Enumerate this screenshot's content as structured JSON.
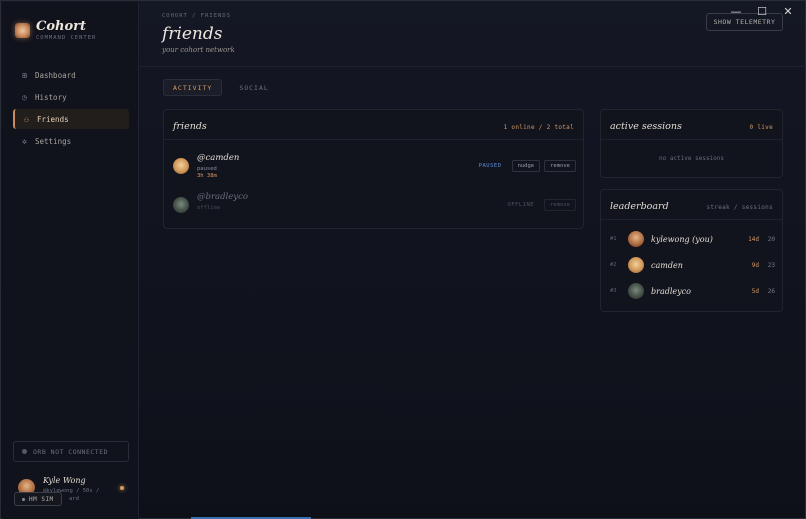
{
  "window": {
    "controls": [
      "—",
      "☐",
      "✕"
    ]
  },
  "brand": {
    "name": "Cohort",
    "subtitle": "COMMAND CENTER"
  },
  "nav": [
    {
      "label": "Dashboard",
      "icon": "grid-icon",
      "glyph": "⊞"
    },
    {
      "label": "History",
      "icon": "clock-icon",
      "glyph": "◷"
    },
    {
      "label": "Friends",
      "icon": "users-icon",
      "glyph": "⚇",
      "active": true
    },
    {
      "label": "Settings",
      "icon": "gear-icon",
      "glyph": "✲"
    }
  ],
  "orb": {
    "label": "ORB NOT CONNECTED"
  },
  "user": {
    "name": "Kyle Wong",
    "meta1": "@kylewong / 50s /",
    "meta2": "ard"
  },
  "hmsim": {
    "label": "HM SIM"
  },
  "header": {
    "breadcrumb": "COHORT / FRIENDS",
    "title": "friends",
    "subtitle": "your cohort network",
    "telemetry_button": "SHOW TELEMETRY"
  },
  "tabs": [
    {
      "label": "ACTIVITY",
      "active": true
    },
    {
      "label": "SOCIAL",
      "active": false
    }
  ],
  "friends_card": {
    "title": "friends",
    "count": "1 online / 2 total",
    "rows": [
      {
        "name": "@camden",
        "status": "paused",
        "time": "3h 38m",
        "badge": "PAUSED",
        "actions": [
          "nudge",
          "remove"
        ]
      },
      {
        "name": "@bradleyco",
        "status": "offline",
        "time": "",
        "badge": "OFFLINE",
        "actions": [
          "remove"
        ]
      }
    ]
  },
  "sessions_card": {
    "title": "active sessions",
    "count": "0 live",
    "empty": "no active sessions"
  },
  "leaderboard": {
    "title": "leaderboard",
    "columns": "streak / sessions",
    "rows": [
      {
        "rank": "#1",
        "name": "kylewong (you)",
        "streak": "14d",
        "sessions": "20"
      },
      {
        "rank": "#2",
        "name": "camden",
        "streak": "9d",
        "sessions": "23"
      },
      {
        "rank": "#3",
        "name": "bradleyco",
        "streak": "5d",
        "sessions": "26"
      }
    ]
  },
  "colors": {
    "accent": "#d99a62",
    "paused": "#5d8fd9",
    "bg": "#0d0f18"
  }
}
